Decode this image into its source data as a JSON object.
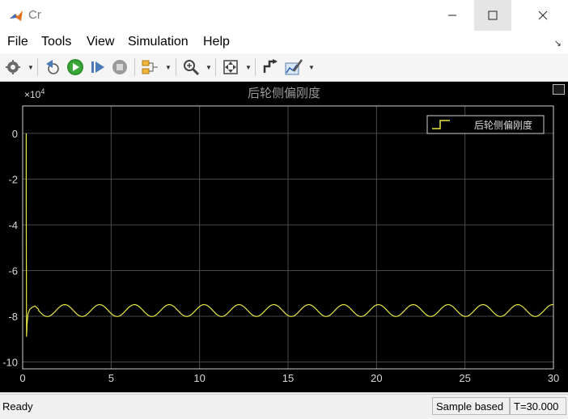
{
  "window": {
    "title": "Cr"
  },
  "menu": [
    "File",
    "Tools",
    "View",
    "Simulation",
    "Help"
  ],
  "toolbar": {
    "icons": [
      "gear-icon",
      "rewind-icon",
      "run-icon",
      "step-forward-icon",
      "stop-icon",
      "signal-highlight-icon",
      "zoom-icon",
      "fit-to-view-icon",
      "cursor-measure-icon",
      "style-icon"
    ]
  },
  "status": {
    "ready": "Ready",
    "mode": "Sample based",
    "time": "T=30.000"
  },
  "chart_data": {
    "type": "line",
    "title": "后轮侧偏刚度",
    "exponent_label": "×10",
    "exponent_power": "4",
    "xlim": [
      0,
      30
    ],
    "ylim": [
      -10.3,
      1.2
    ],
    "xticks": [
      "0",
      "5",
      "10",
      "15",
      "20",
      "25",
      "30"
    ],
    "yticks": [
      "0",
      "-2",
      "-4",
      "-6",
      "-8",
      "-10"
    ],
    "ytick_values": [
      0,
      -2,
      -4,
      -6,
      -8,
      -10
    ],
    "xtick_values": [
      0,
      5,
      10,
      15,
      20,
      25,
      30
    ],
    "grid": true,
    "legend": {
      "position": "top-right"
    },
    "series": [
      {
        "name": "后轮侧偏刚度",
        "color": "#e8e848",
        "x": [
          0.2,
          0.2,
          0.22,
          0.25,
          0.3,
          0.4,
          0.55,
          0.7,
          0.9
        ],
        "y": [
          0,
          -3.0,
          -8.9,
          -8.3,
          -7.9,
          -7.7,
          -7.6,
          -7.55,
          -7.7
        ],
        "oscillation": {
          "start": 0.9,
          "end": 30,
          "center": -7.75,
          "amplitude": 0.26,
          "period": 1.97
        }
      }
    ]
  }
}
